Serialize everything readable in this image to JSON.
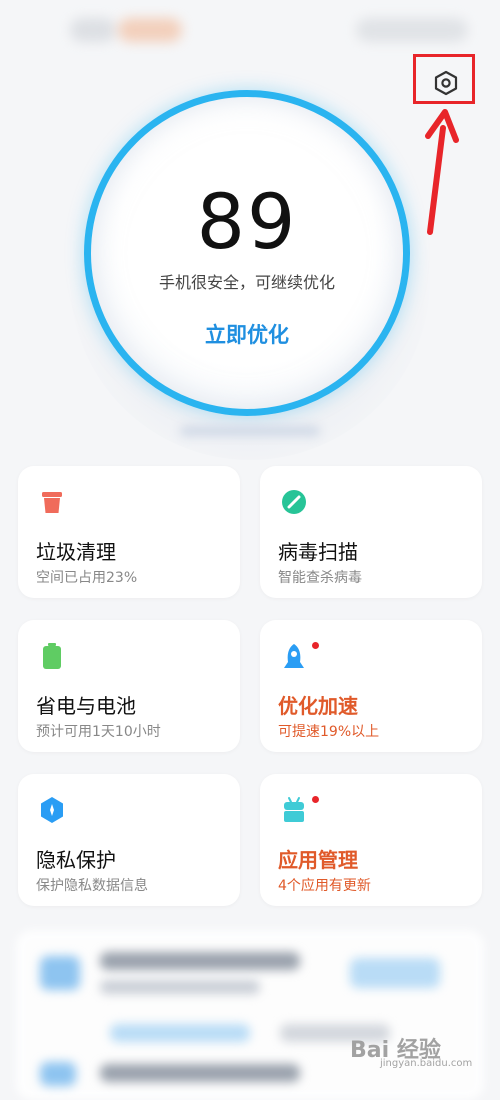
{
  "score": {
    "value": "89",
    "status": "手机很安全，可继续优化",
    "action": "立即优化"
  },
  "cards": [
    {
      "title": "垃圾清理",
      "subtitle": "空间已占用23%",
      "icon": "trash-icon",
      "color": "#f06b5b"
    },
    {
      "title": "病毒扫描",
      "subtitle": "智能查杀病毒",
      "icon": "virus-scan-icon",
      "color": "#27c497"
    },
    {
      "title": "省电与电池",
      "subtitle": "预计可用1天10小时",
      "icon": "battery-icon",
      "color": "#5fcc63"
    },
    {
      "title": "优化加速",
      "subtitle": "可提速19%以上",
      "icon": "rocket-icon",
      "color": "#2a9df4"
    },
    {
      "title": "隐私保护",
      "subtitle": "保护隐私数据信息",
      "icon": "privacy-shield-icon",
      "color": "#2a9df4"
    },
    {
      "title": "应用管理",
      "subtitle": "4个应用有更新",
      "icon": "app-manage-icon",
      "color": "#3fcbd6"
    }
  ],
  "watermark": {
    "text": "Bai 经验",
    "sub": "jingyan.baidu.com"
  },
  "colors": {
    "ring": "#2ab4f0",
    "accent": "#1f8fe0",
    "warning": "#e05a2a",
    "highlight": "#e8252a"
  }
}
